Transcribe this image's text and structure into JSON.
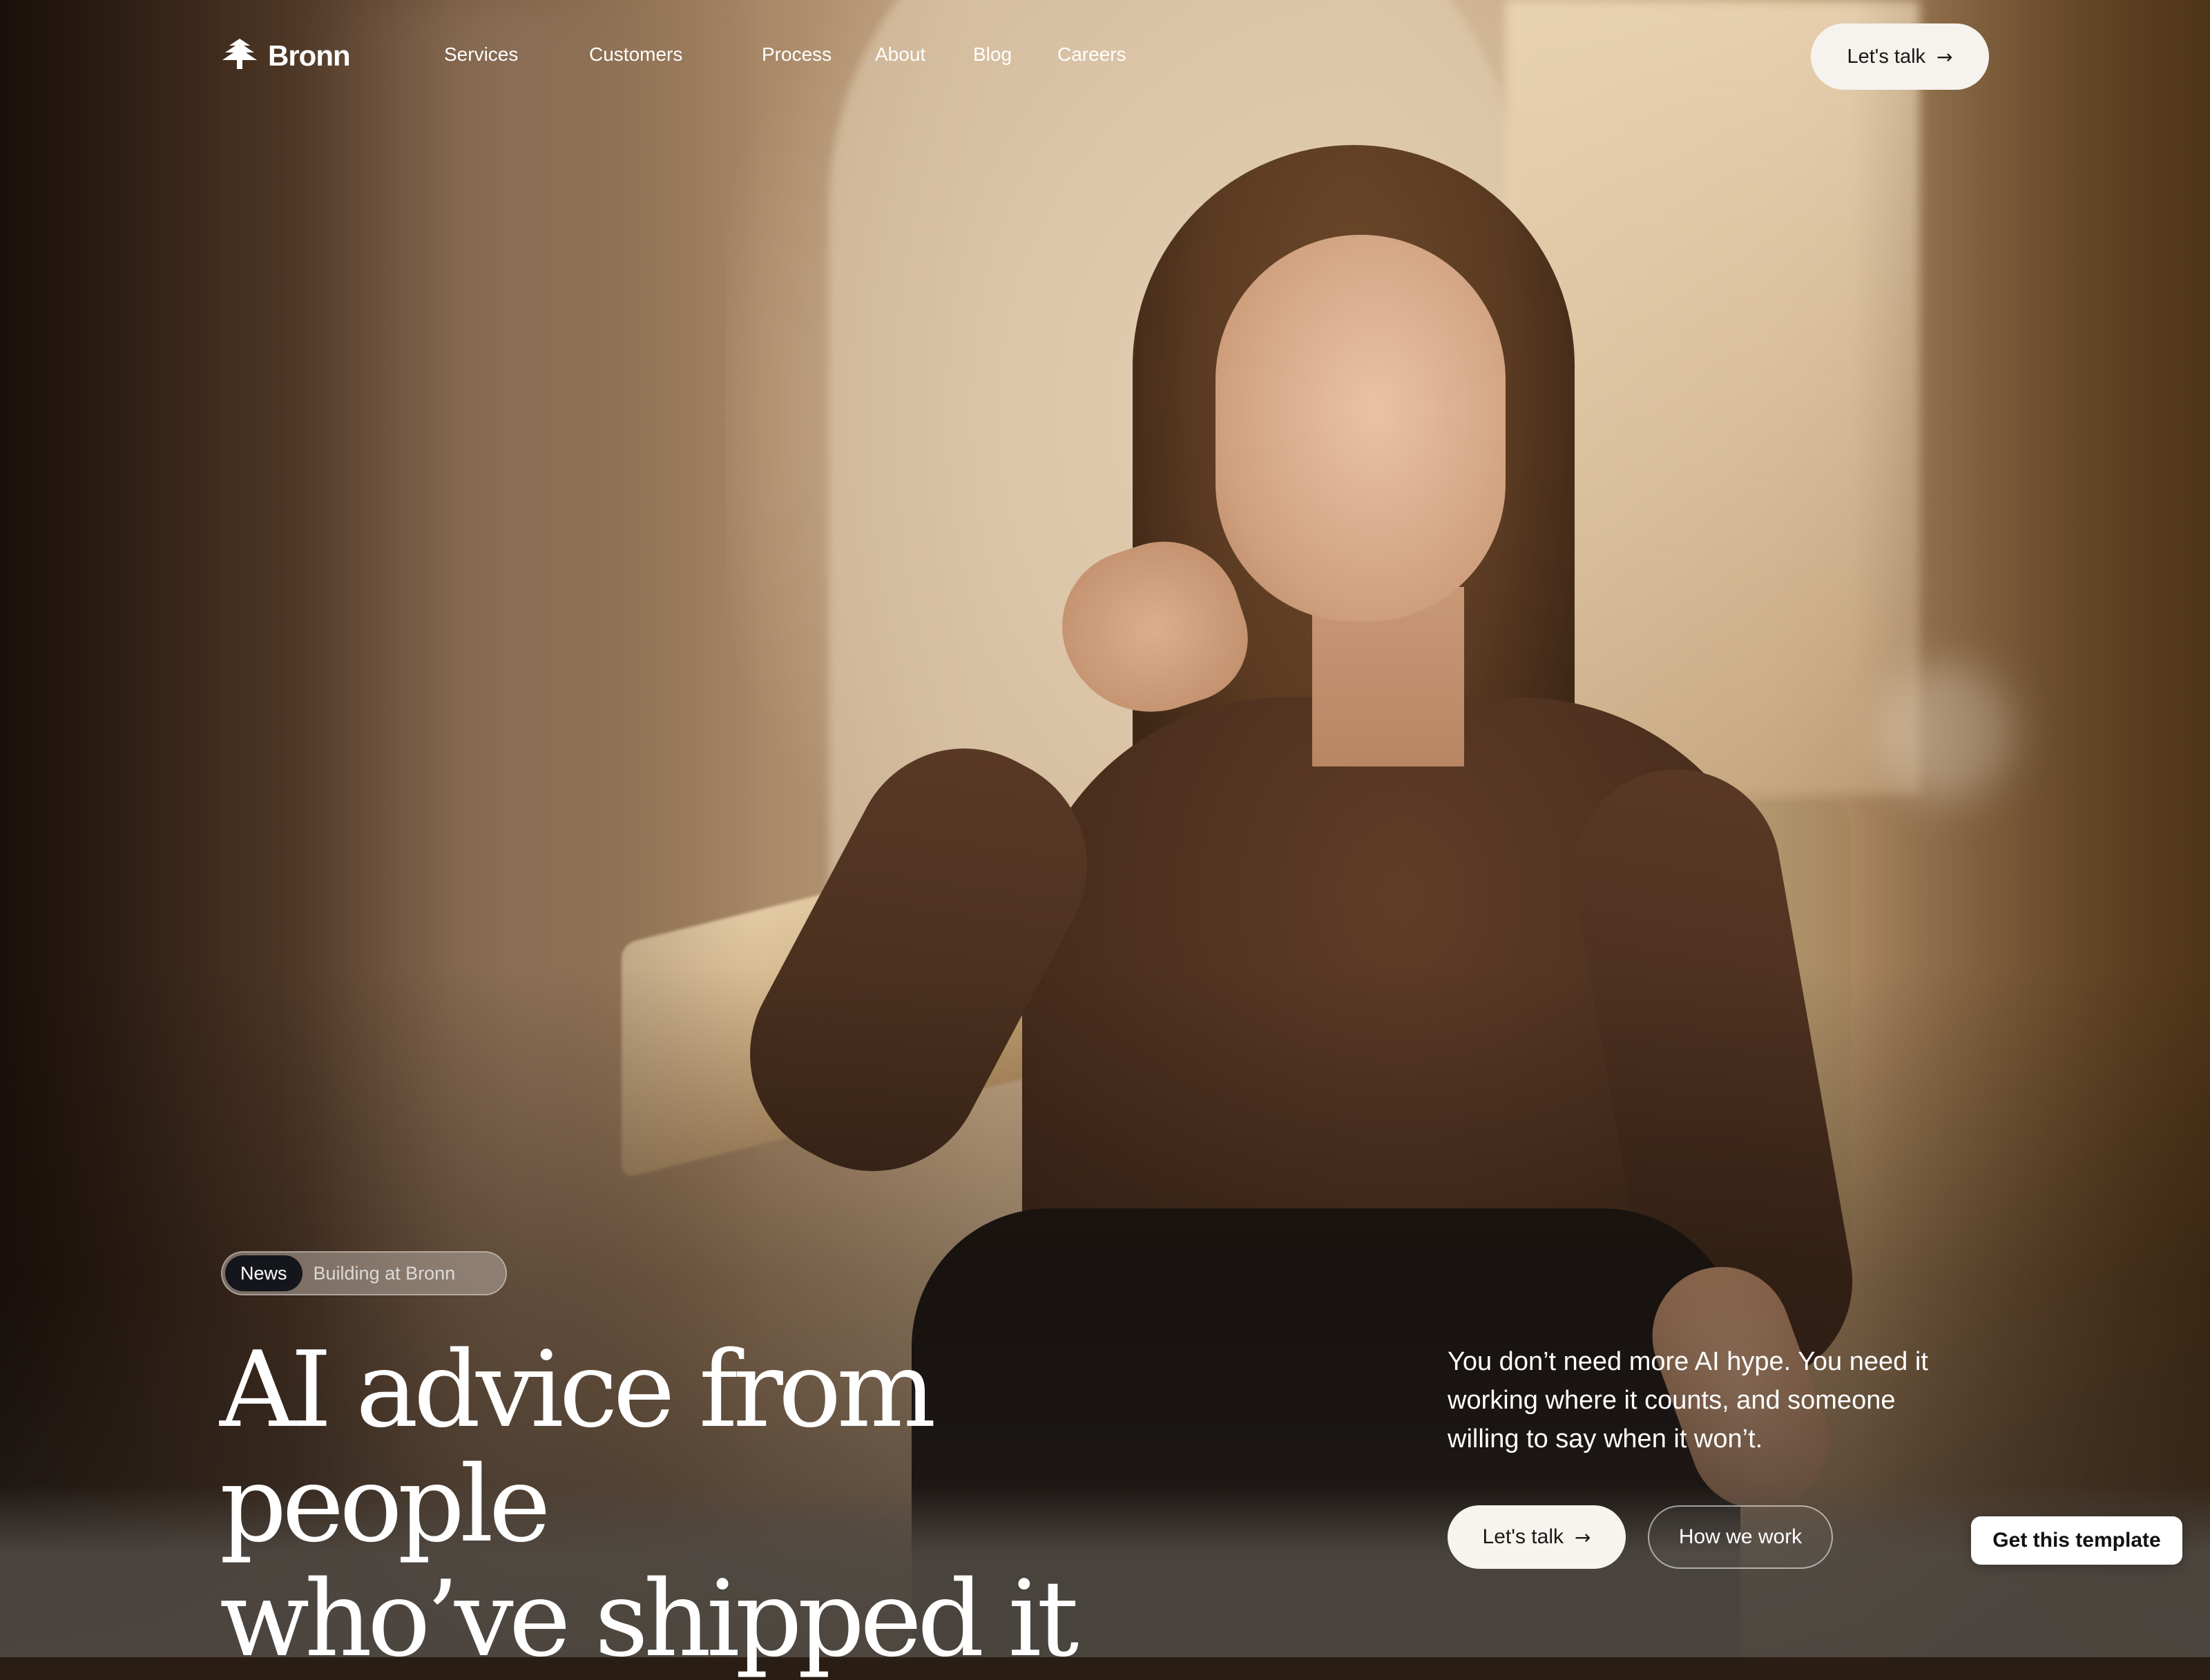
{
  "brand": {
    "name": "Bronn",
    "logo_icon": "pine-tree-icon"
  },
  "nav": {
    "links": [
      "Services",
      "Customers",
      "Process",
      "About",
      "Blog",
      "Careers"
    ],
    "cta_label": "Let's talk",
    "cta_icon": "arrow-right-icon"
  },
  "hero": {
    "badge_tag": "News",
    "badge_text": "Building at Bronn",
    "headline_line1": "AI advice from people",
    "headline_line2": "who’ve shipped it",
    "lede": "You don’t need more AI hype. You need it working where it counts, and someone willing to say when it won’t.",
    "primary_cta": "Let's talk",
    "secondary_cta": "How we work"
  },
  "template_button": "Get this template",
  "colors": {
    "button_light": "#f6f3ee",
    "badge_dark": "#14161c",
    "text": "#ffffff"
  }
}
